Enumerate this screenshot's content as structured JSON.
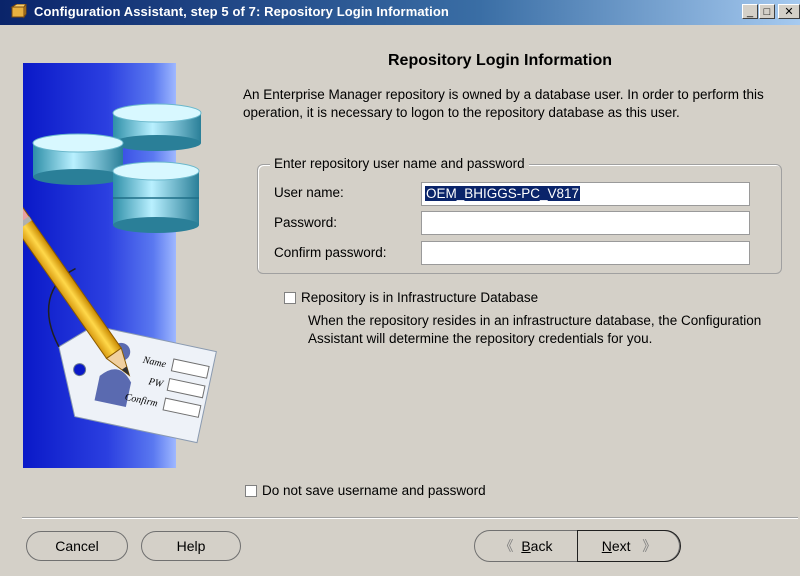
{
  "window": {
    "title": "Configuration Assistant, step 5 of 7: Repository Login Information",
    "controls": {
      "minimize": "_",
      "maximize": "□",
      "close": "✕"
    }
  },
  "page": {
    "heading": "Repository Login Information",
    "description": "An Enterprise Manager repository is owned by a database user.  In order to perform this operation, it is necessary to logon to the repository database as this user."
  },
  "credentials": {
    "group_label": "Enter repository user name and password",
    "username_label": "User name:",
    "username_value": "OEM_BHIGGS-PC_V817",
    "password_label": "Password:",
    "password_value": "",
    "confirm_label": "Confirm password:",
    "confirm_value": ""
  },
  "infra_option": {
    "label": "Repository is in Infrastructure Database",
    "checked": false,
    "description": "When the repository resides in an infrastructure database, the Configuration Assistant will determine the repository credentials for you."
  },
  "save_option": {
    "label": "Do not save username and password",
    "checked": false
  },
  "graphic": {
    "tag_labels": {
      "name": "Name",
      "pw": "PW",
      "confirm": "Confirm"
    }
  },
  "buttons": {
    "cancel": "Cancel",
    "help": "Help",
    "back_prefix": "",
    "back_mnemonic": "B",
    "back_rest": "ack",
    "next_mnemonic": "N",
    "next_rest": "ext"
  },
  "icons": {
    "back_arrow": "《",
    "next_arrow": "》"
  },
  "colors": {
    "titlebar_start": "#0a246a",
    "selection": "#0a246a",
    "panel_blue": "#0a19c8"
  }
}
